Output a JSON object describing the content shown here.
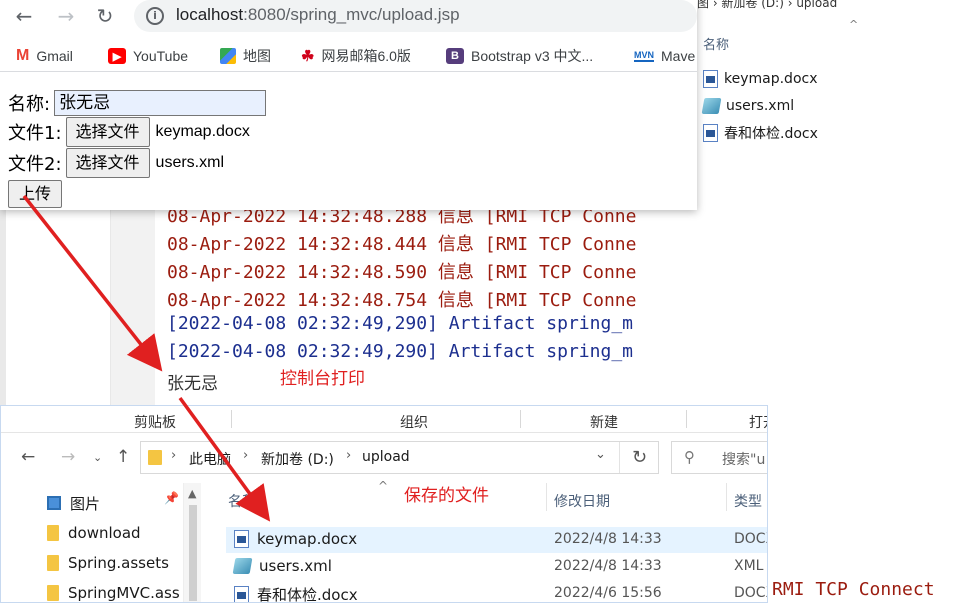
{
  "bg_explorer": {
    "crumb": "图 › 新加卷 (D:) › upload",
    "column_name": "名称",
    "files": [
      {
        "name": "keymap.docx",
        "icon": "word-doc-icon"
      },
      {
        "name": "users.xml",
        "icon": "xml-file-icon"
      },
      {
        "name": "春和体检.docx",
        "icon": "word-doc-icon"
      }
    ]
  },
  "browser": {
    "url_host": "localhost",
    "url_rest": ":8080/spring_mvc/upload.jsp",
    "bookmarks": [
      {
        "label": "Gmail",
        "icon": "gmail-icon"
      },
      {
        "label": "YouTube",
        "icon": "youtube-icon"
      },
      {
        "label": "地图",
        "icon": "maps-icon"
      },
      {
        "label": "网易邮箱6.0版",
        "icon": "netease-mail-icon"
      },
      {
        "label": "Bootstrap v3 中文...",
        "icon": "bootstrap-icon"
      },
      {
        "label": "Mave",
        "icon": "maven-icon"
      }
    ],
    "form": {
      "name_label": "名称:",
      "name_value": "张无忌",
      "file1_label": "文件1:",
      "file2_label": "文件2:",
      "choose_button": "选择文件",
      "file1_name": "keymap.docx",
      "file2_name": "users.xml",
      "submit_label": "上传"
    }
  },
  "console": {
    "lines": [
      {
        "text": "08-Apr-2022 14:32:48.288 信息 [RMI TCP Conne",
        "color": "red"
      },
      {
        "text": "08-Apr-2022 14:32:48.444 信息 [RMI TCP Conne",
        "color": "red"
      },
      {
        "text": "08-Apr-2022 14:32:48.590 信息 [RMI TCP Conne",
        "color": "red"
      },
      {
        "text": "08-Apr-2022 14:32:48.754 信息 [RMI TCP Conne",
        "color": "red"
      },
      {
        "text": "[2022-04-08 02:32:49,290] Artifact spring_m",
        "color": "blue"
      },
      {
        "text": "[2022-04-08 02:32:49,290] Artifact spring_m",
        "color": "blue"
      }
    ],
    "output": "张无忌",
    "strip_text": "RMI TCP Connect"
  },
  "explorer": {
    "ribbon": [
      "剪贴板",
      "组织",
      "新建",
      "打开"
    ],
    "path": [
      "此电脑",
      "新加卷 (D:)",
      "upload"
    ],
    "search_placeholder": "搜索\"u",
    "nav_items": [
      {
        "label": "图片",
        "icon": "pictures-icon"
      },
      {
        "label": "download",
        "icon": "folder-icon"
      },
      {
        "label": "Spring.assets",
        "icon": "folder-icon"
      },
      {
        "label": "SpringMVC.ass",
        "icon": "folder-icon"
      }
    ],
    "columns": {
      "name": "名称",
      "date": "修改日期",
      "type": "类型"
    },
    "files": [
      {
        "name": "keymap.docx",
        "date": "2022/4/8 14:33",
        "type": "DOCX",
        "icon": "word-doc-icon"
      },
      {
        "name": "users.xml",
        "date": "2022/4/8 14:33",
        "type": "XML",
        "icon": "xml-file-icon"
      },
      {
        "name": "春和体检.docx",
        "date": "2022/4/6 15:56",
        "type": "DOCX",
        "icon": "word-doc-icon"
      }
    ]
  },
  "annotations": {
    "console_label": "控制台打印",
    "saved_label": "保存的文件",
    "color": "#e02020"
  }
}
